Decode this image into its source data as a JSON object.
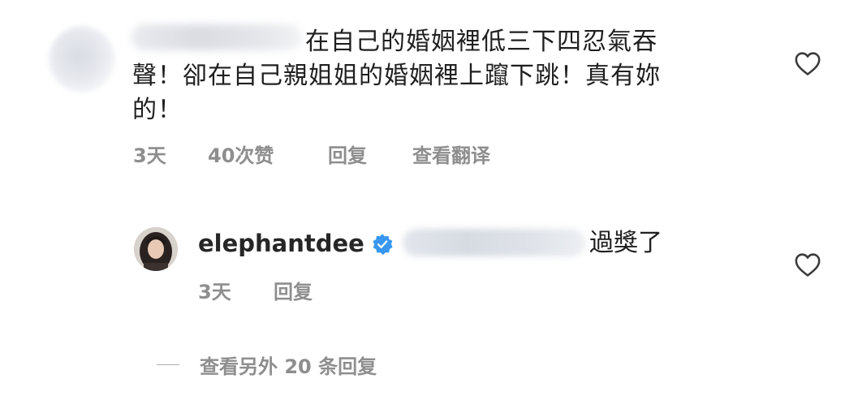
{
  "comment": {
    "text_after_name": "在自己的婚姻裡低三下四忍氣吞",
    "text_line2": "聲！卻在自己親姐姐的婚姻裡上躥下跳！真有妳",
    "text_line3": "的！",
    "time": "3天",
    "likes": "40次赞",
    "reply_label": "回复",
    "translate_label": "查看翻译"
  },
  "reply": {
    "username": "elephantdee",
    "verified": true,
    "text": "過獎了",
    "time": "3天",
    "reply_label": "回复"
  },
  "view_more": {
    "label": "查看另外 20 条回复"
  },
  "colors": {
    "primary_text": "#1f1f1f",
    "secondary_text": "#8e8e8e",
    "verified_badge": "#3897f0"
  },
  "icons": {
    "like": "heart-outline-icon",
    "verified": "verified-badge-icon"
  }
}
